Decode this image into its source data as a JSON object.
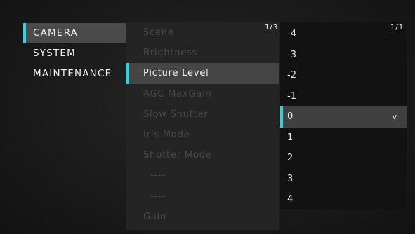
{
  "main_menu": {
    "items": [
      {
        "label": "CAMERA"
      },
      {
        "label": "SYSTEM"
      },
      {
        "label": "MAINTENANCE"
      }
    ],
    "selected": "CAMERA"
  },
  "sub_menu": {
    "page_indicator": "1/3",
    "items": [
      {
        "label": "Scene"
      },
      {
        "label": "Brightness"
      },
      {
        "label": "Picture Level"
      },
      {
        "label": "AGC MaxGain"
      },
      {
        "label": "Slow Shutter"
      },
      {
        "label": "Iris Mode"
      },
      {
        "label": "Shutter Mode"
      },
      {
        "label": "----"
      },
      {
        "label": "----"
      },
      {
        "label": "Gain"
      }
    ],
    "selected": "Picture Level"
  },
  "value_list": {
    "page_indicator": "1/1",
    "items": [
      {
        "label": "-4"
      },
      {
        "label": "-3"
      },
      {
        "label": "-2"
      },
      {
        "label": "-1"
      },
      {
        "label": "0"
      },
      {
        "label": "1"
      },
      {
        "label": "2"
      },
      {
        "label": "3"
      },
      {
        "label": "4"
      }
    ],
    "selected": "0",
    "selected_marker": "v"
  },
  "colors": {
    "accent": "#2fd3dc",
    "highlight": "#454545",
    "dim_text": "#4a4a4a",
    "text": "#f2f2f2"
  }
}
